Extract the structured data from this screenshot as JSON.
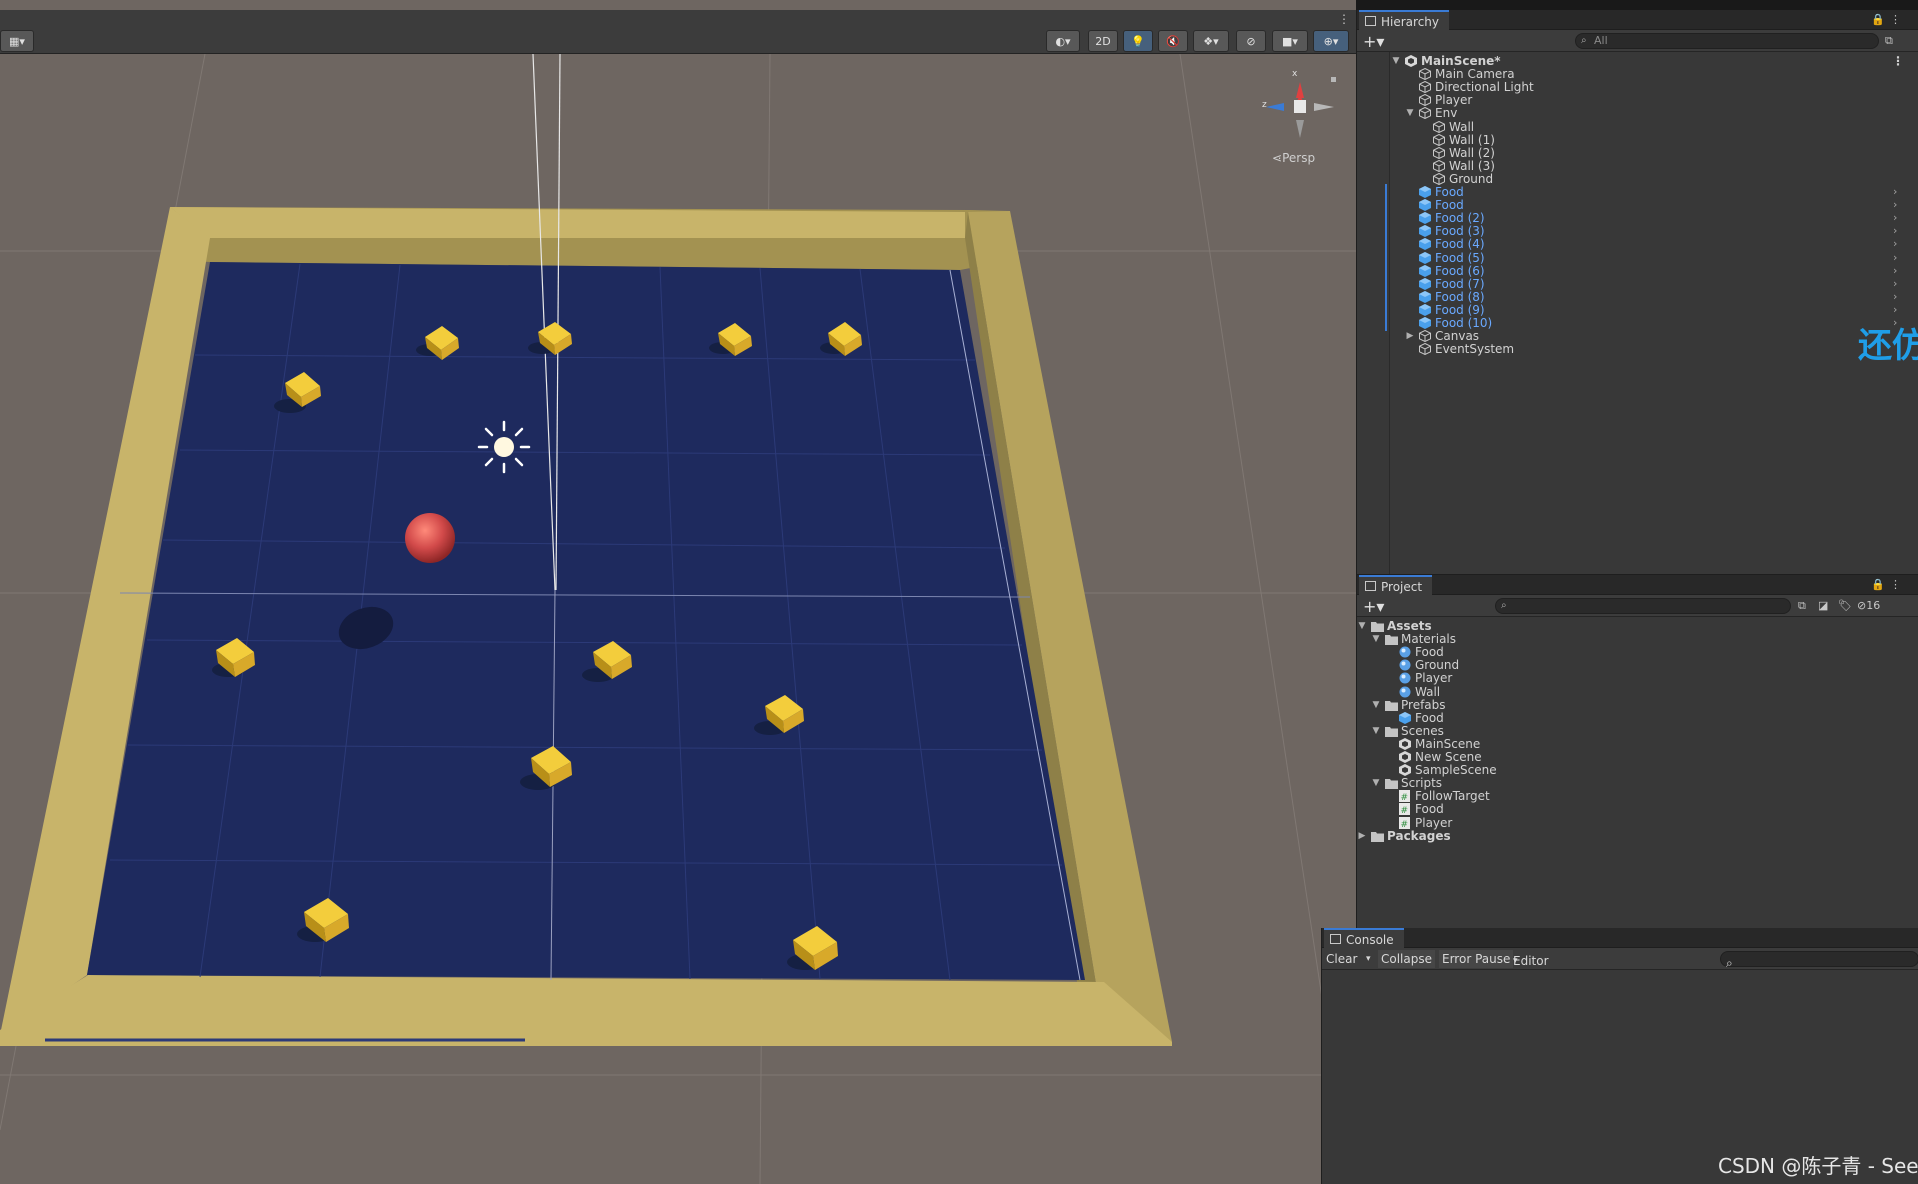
{
  "scene": {
    "toolbar": {
      "mode_2d_label": "2D"
    },
    "gizmo": {
      "x_label": "x",
      "z_label": "z",
      "projection_label": "Persp"
    },
    "watermark": "CSDN @陈子青 - See",
    "overlay_chars": "还仿",
    "colors": {
      "ground": "#1e2a5e",
      "wall": "#c8b46a",
      "food": "#e2b527",
      "player": "#d24a4a",
      "background": "#6e6661"
    }
  },
  "hierarchy": {
    "title": "Hierarchy",
    "search_placeholder": "All",
    "items": [
      {
        "label": "MainScene*",
        "icon": "unity-scene-icon",
        "depth": 0,
        "expanded": true,
        "bold": true
      },
      {
        "label": "Main Camera",
        "icon": "gameobject-icon",
        "depth": 1
      },
      {
        "label": "Directional Light",
        "icon": "gameobject-icon",
        "depth": 1
      },
      {
        "label": "Player",
        "icon": "gameobject-icon",
        "depth": 1
      },
      {
        "label": "Env",
        "icon": "gameobject-icon",
        "depth": 1,
        "expanded": true
      },
      {
        "label": "Wall",
        "icon": "gameobject-icon",
        "depth": 2
      },
      {
        "label": "Wall (1)",
        "icon": "gameobject-icon",
        "depth": 2
      },
      {
        "label": "Wall (2)",
        "icon": "gameobject-icon",
        "depth": 2
      },
      {
        "label": "Wall (3)",
        "icon": "gameobject-icon",
        "depth": 2
      },
      {
        "label": "Ground",
        "icon": "gameobject-icon",
        "depth": 2
      },
      {
        "label": "Food",
        "icon": "prefab-icon",
        "depth": 1,
        "prefab": true
      },
      {
        "label": "Food",
        "icon": "prefab-icon",
        "depth": 1,
        "prefab": true
      },
      {
        "label": "Food (2)",
        "icon": "prefab-icon",
        "depth": 1,
        "prefab": true
      },
      {
        "label": "Food (3)",
        "icon": "prefab-icon",
        "depth": 1,
        "prefab": true
      },
      {
        "label": "Food (4)",
        "icon": "prefab-icon",
        "depth": 1,
        "prefab": true
      },
      {
        "label": "Food (5)",
        "icon": "prefab-icon",
        "depth": 1,
        "prefab": true
      },
      {
        "label": "Food (6)",
        "icon": "prefab-icon",
        "depth": 1,
        "prefab": true
      },
      {
        "label": "Food (7)",
        "icon": "prefab-icon",
        "depth": 1,
        "prefab": true
      },
      {
        "label": "Food (8)",
        "icon": "prefab-icon",
        "depth": 1,
        "prefab": true
      },
      {
        "label": "Food (9)",
        "icon": "prefab-icon",
        "depth": 1,
        "prefab": true
      },
      {
        "label": "Food (10)",
        "icon": "prefab-icon",
        "depth": 1,
        "prefab": true
      },
      {
        "label": "Canvas",
        "icon": "gameobject-icon",
        "depth": 1,
        "collapsed": true
      },
      {
        "label": "EventSystem",
        "icon": "gameobject-icon",
        "depth": 1
      }
    ]
  },
  "project": {
    "title": "Project",
    "hidden_count": "16",
    "items": [
      {
        "label": "Assets",
        "icon": "folder-icon",
        "depth": 0,
        "expanded": true,
        "bold": true
      },
      {
        "label": "Materials",
        "icon": "folder-icon",
        "depth": 1,
        "expanded": true
      },
      {
        "label": "Food",
        "icon": "material-icon",
        "depth": 2
      },
      {
        "label": "Ground",
        "icon": "material-icon",
        "depth": 2
      },
      {
        "label": "Player",
        "icon": "material-icon",
        "depth": 2
      },
      {
        "label": "Wall",
        "icon": "material-icon",
        "depth": 2
      },
      {
        "label": "Prefabs",
        "icon": "folder-icon",
        "depth": 1,
        "expanded": true
      },
      {
        "label": "Food",
        "icon": "prefab-icon",
        "depth": 2
      },
      {
        "label": "Scenes",
        "icon": "folder-icon",
        "depth": 1,
        "expanded": true
      },
      {
        "label": "MainScene",
        "icon": "unity-scene-icon",
        "depth": 2
      },
      {
        "label": "New Scene",
        "icon": "unity-scene-icon",
        "depth": 2
      },
      {
        "label": "SampleScene",
        "icon": "unity-scene-icon",
        "depth": 2
      },
      {
        "label": "Scripts",
        "icon": "folder-icon",
        "depth": 1,
        "expanded": true
      },
      {
        "label": "FollowTarget",
        "icon": "script-icon",
        "depth": 2
      },
      {
        "label": "Food",
        "icon": "script-icon",
        "depth": 2
      },
      {
        "label": "Player",
        "icon": "script-icon",
        "depth": 2
      },
      {
        "label": "Packages",
        "icon": "folder-icon",
        "depth": 0,
        "collapsed": true,
        "bold": true
      }
    ]
  },
  "console": {
    "title": "Console",
    "buttons": {
      "clear": "Clear",
      "collapse": "Collapse",
      "error_pause": "Error Pause",
      "editor": "Editor"
    }
  }
}
